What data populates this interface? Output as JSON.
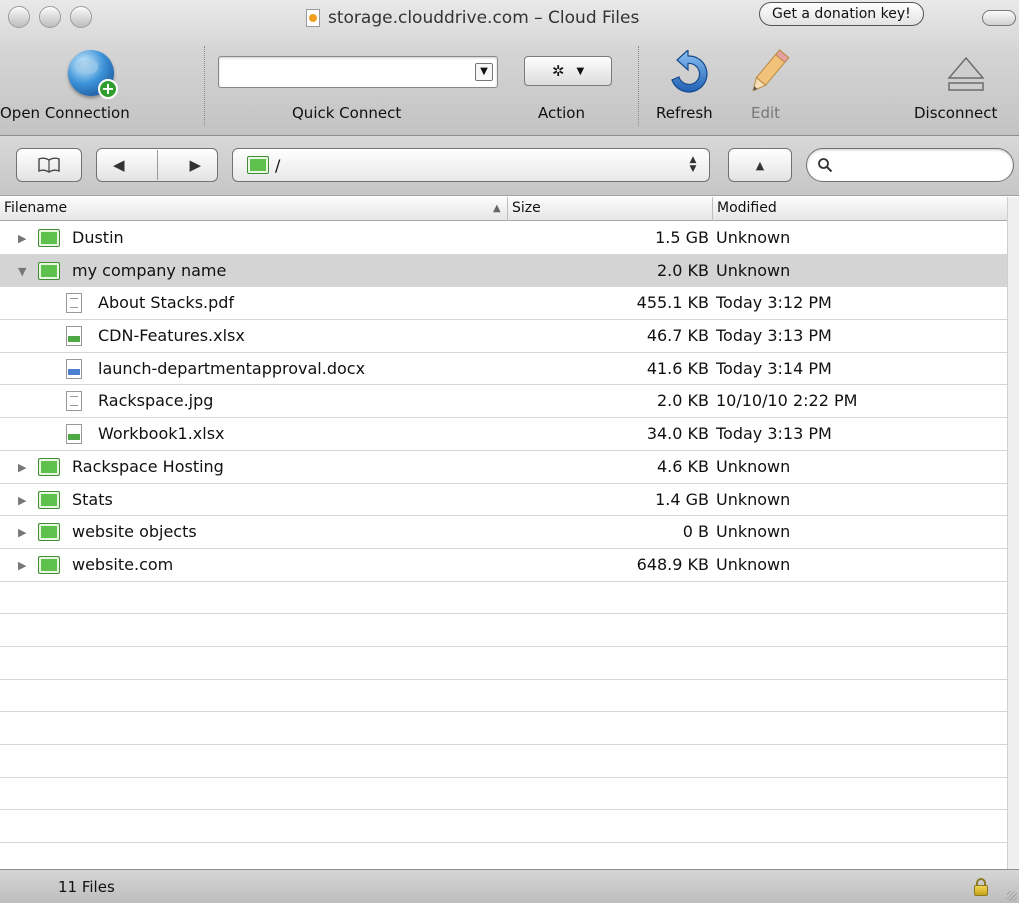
{
  "window": {
    "title": "storage.clouddrive.com – Cloud Files",
    "donation_label": "Get a donation key!"
  },
  "toolbar": {
    "open_connection": "Open Connection",
    "quick_connect": "Quick Connect",
    "quick_connect_value": "",
    "action": "Action",
    "refresh": "Refresh",
    "edit": "Edit",
    "disconnect": "Disconnect"
  },
  "navbar": {
    "path": "/",
    "search_value": ""
  },
  "columns": {
    "filename": "Filename",
    "size": "Size",
    "modified": "Modified"
  },
  "rows": [
    {
      "name": "Dustin",
      "size": "1.5 GB",
      "modified": "Unknown",
      "kind": "folder",
      "expanded": false
    },
    {
      "name": "my company name",
      "size": "2.0 KB",
      "modified": "Unknown",
      "kind": "folder",
      "expanded": true
    },
    {
      "name": "About Stacks.pdf",
      "size": "455.1 KB",
      "modified": "Today 3:12 PM",
      "kind": "plain"
    },
    {
      "name": "CDN-Features.xlsx",
      "size": "46.7 KB",
      "modified": "Today 3:13 PM",
      "kind": "xlsx"
    },
    {
      "name": "launch-departmentapproval.docx",
      "size": "41.6 KB",
      "modified": "Today 3:14 PM",
      "kind": "docx"
    },
    {
      "name": "Rackspace.jpg",
      "size": "2.0 KB",
      "modified": "10/10/10 2:22 PM",
      "kind": "plain"
    },
    {
      "name": "Workbook1.xlsx",
      "size": "34.0 KB",
      "modified": "Today 3:13 PM",
      "kind": "xlsx"
    },
    {
      "name": "Rackspace Hosting",
      "size": "4.6 KB",
      "modified": "Unknown",
      "kind": "folder",
      "expanded": false
    },
    {
      "name": "Stats",
      "size": "1.4 GB",
      "modified": "Unknown",
      "kind": "folder",
      "expanded": false
    },
    {
      "name": "website objects",
      "size": "0 B",
      "modified": "Unknown",
      "kind": "folder",
      "expanded": false
    },
    {
      "name": "website.com",
      "size": "648.9 KB",
      "modified": "Unknown",
      "kind": "folder",
      "expanded": false
    }
  ],
  "status": {
    "text": "11 Files"
  },
  "icons": {
    "open_connection": "globe-plus-icon",
    "action": "gear-icon",
    "refresh": "refresh-icon",
    "edit": "pencil-icon",
    "disconnect": "eject-icon",
    "bookmarks": "book-icon",
    "search": "search-icon",
    "lock": "lock-icon"
  },
  "colors": {
    "folder": "#5ec14e",
    "selection": "#d4d4d4",
    "refresh_blue": "#2f73c8"
  }
}
